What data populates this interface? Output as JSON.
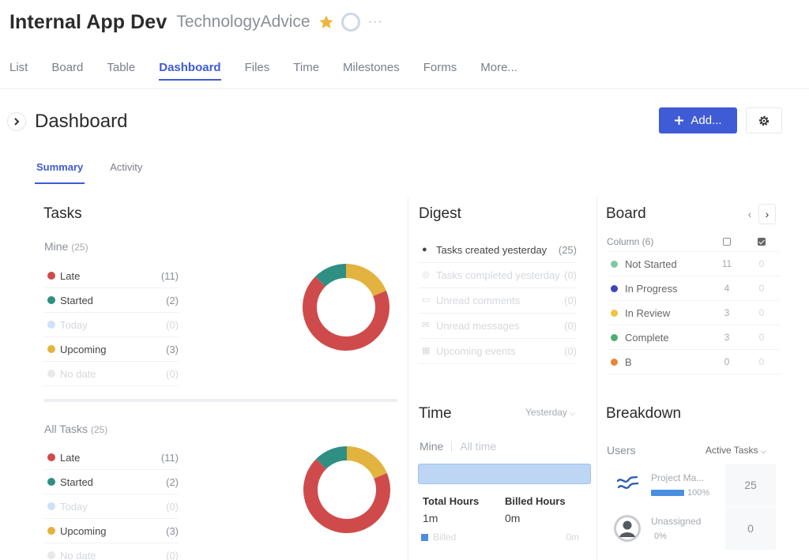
{
  "project": {
    "title": "Internal App Dev",
    "company": "TechnologyAdvice",
    "star_color": "#f0b43c",
    "more": "···"
  },
  "nav": {
    "tabs": [
      {
        "label": "List"
      },
      {
        "label": "Board"
      },
      {
        "label": "Table"
      },
      {
        "label": "Dashboard",
        "active": true
      },
      {
        "label": "Files"
      },
      {
        "label": "Time"
      },
      {
        "label": "Milestones"
      },
      {
        "label": "Forms"
      },
      {
        "label": "More..."
      }
    ]
  },
  "dashboard": {
    "title": "Dashboard",
    "add_label": "Add...",
    "add_icon": "plus-icon",
    "settings_icon": "gear-icon",
    "sub_tabs": [
      {
        "label": "Summary",
        "active": true
      },
      {
        "label": "Activity"
      }
    ]
  },
  "tasks": {
    "title": "Tasks",
    "mine": {
      "label": "Mine",
      "count": "(25)",
      "rows": [
        {
          "label": "Late",
          "value": "(11)",
          "color": "#cf4b4b",
          "muted": false
        },
        {
          "label": "Started",
          "value": "(2)",
          "color": "#2f8f83",
          "muted": false
        },
        {
          "label": "Today",
          "value": "(0)",
          "color": "#cfe1f7",
          "muted": true
        },
        {
          "label": "Upcoming",
          "value": "(3)",
          "color": "#e2b33f",
          "muted": false
        },
        {
          "label": "No date",
          "value": "(0)",
          "color": "#e6e8ec",
          "muted": true
        }
      ],
      "donut": [
        {
          "value": 11,
          "color": "#cf4b4b"
        },
        {
          "value": 2,
          "color": "#2f8f83"
        },
        {
          "value": 3,
          "color": "#e2b33f"
        }
      ]
    },
    "all": {
      "label": "All Tasks",
      "count": "(25)",
      "rows": [
        {
          "label": "Late",
          "value": "(11)",
          "color": "#cf4b4b",
          "muted": false
        },
        {
          "label": "Started",
          "value": "(2)",
          "color": "#2f8f83",
          "muted": false
        },
        {
          "label": "Today",
          "value": "(0)",
          "color": "#cfe1f7",
          "muted": true
        },
        {
          "label": "Upcoming",
          "value": "(3)",
          "color": "#e2b33f",
          "muted": false
        },
        {
          "label": "No date",
          "value": "(0)",
          "color": "#e6e8ec",
          "muted": true
        }
      ],
      "donut": [
        {
          "value": 11,
          "color": "#cf4b4b"
        },
        {
          "value": 2,
          "color": "#2f8f83"
        },
        {
          "value": 3,
          "color": "#e2b33f"
        }
      ]
    }
  },
  "digest": {
    "title": "Digest",
    "rows": [
      {
        "icon": "plus-circle-icon",
        "glyph": "●",
        "label": "Tasks created yesterday",
        "value": "(25)",
        "muted": false
      },
      {
        "icon": "check-circle-icon",
        "glyph": "◎",
        "label": "Tasks completed yesterday",
        "value": "(0)",
        "muted": true
      },
      {
        "icon": "comment-icon",
        "glyph": "▭",
        "label": "Unread comments",
        "value": "(0)",
        "muted": true
      },
      {
        "icon": "envelope-icon",
        "glyph": "✉",
        "label": "Unread messages",
        "value": "(0)",
        "muted": true
      },
      {
        "icon": "calendar-icon",
        "glyph": "▦",
        "label": "Upcoming events",
        "value": "(0)",
        "muted": true
      }
    ]
  },
  "time": {
    "title": "Time",
    "range": "Yesterday",
    "tab_mine": "Mine",
    "tab_all": "All time",
    "total_label": "Total Hours",
    "total_value": "1m",
    "billed_label": "Billed Hours",
    "billed_value": "0m",
    "legend_label": "Billed",
    "legend_value": "0m"
  },
  "board": {
    "title": "Board",
    "column_header": "Column (6)",
    "rows": [
      {
        "label": "Not Started",
        "c1": "11",
        "c2": "0",
        "color": "#7cc9a4"
      },
      {
        "label": "In Progress",
        "c1": "4",
        "c2": "0",
        "color": "#3d46b8"
      },
      {
        "label": "In Review",
        "c1": "3",
        "c2": "0",
        "color": "#f0c340"
      },
      {
        "label": "Complete",
        "c1": "3",
        "c2": "0",
        "color": "#4caf6d"
      },
      {
        "label": "B",
        "c1": "0",
        "c2": "0",
        "color": "#e8853c"
      }
    ]
  },
  "breakdown": {
    "title": "Breakdown",
    "users_label": "Users",
    "selector": "Active Tasks",
    "users": [
      {
        "name": "Project Ma...",
        "percent": "100%",
        "fill": 1.0,
        "count": "25",
        "avatar": "project-logo-icon"
      },
      {
        "name": "Unassigned",
        "percent": "0%",
        "fill": 0.0,
        "count": "0",
        "avatar": "user-avatar-icon"
      }
    ]
  }
}
